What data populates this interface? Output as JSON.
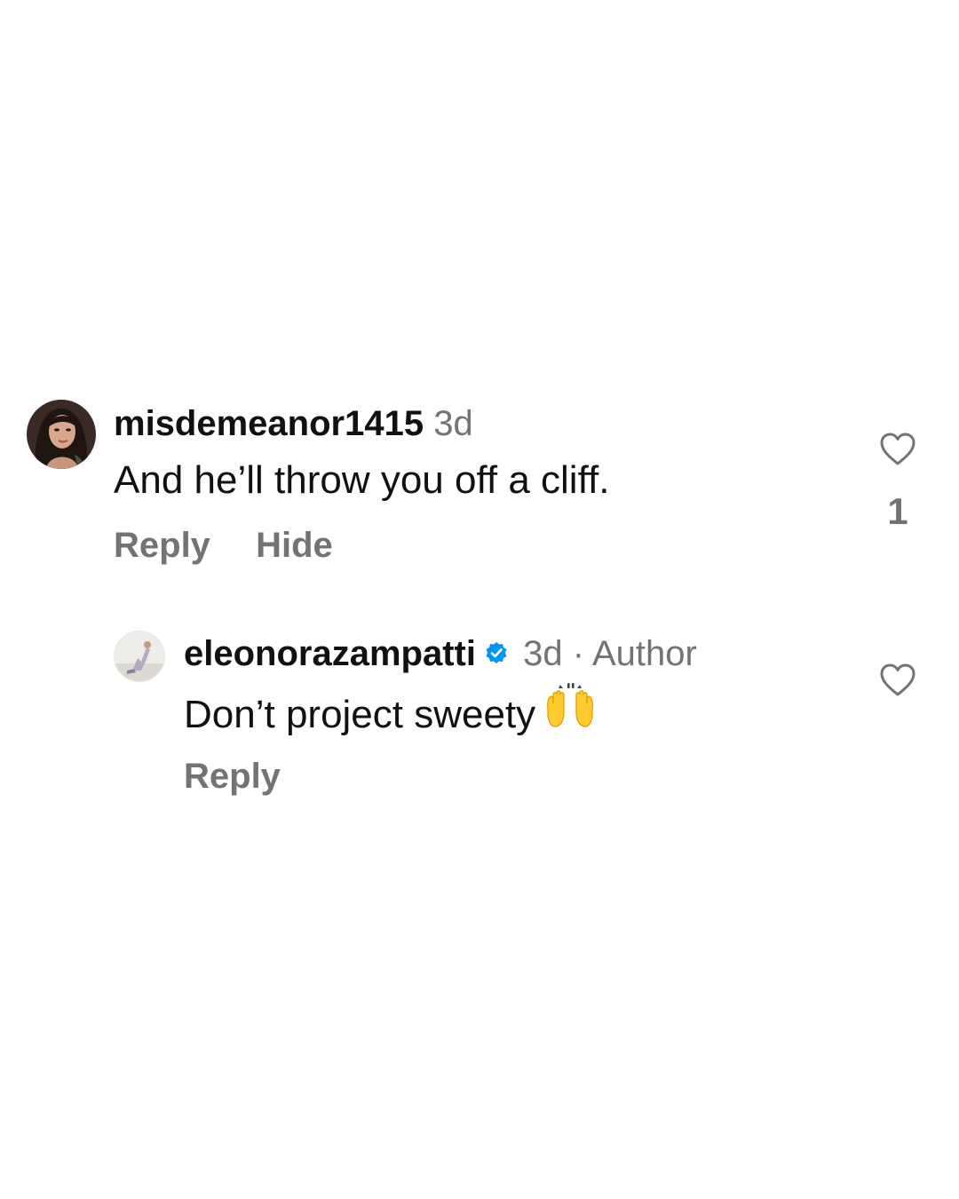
{
  "comments": [
    {
      "username": "misdemeanor1415",
      "time": "3d",
      "text": "And he’ll throw you off a cliff.",
      "actions": [
        "Reply",
        "Hide"
      ],
      "like_count": "1",
      "like_icon": "heart-outline-icon"
    },
    {
      "username": "eleonorazampatti",
      "verified": true,
      "time": "3d",
      "separator": "·",
      "badge": "Author",
      "text": "Don’t project sweety",
      "emoji": "raising-hands-emoji",
      "actions": [
        "Reply"
      ],
      "like_icon": "heart-outline-icon"
    }
  ],
  "colors": {
    "primary_text": "#111111",
    "secondary_text": "#737373",
    "verified_badge": "#0095f6",
    "heart_outline": "#737373"
  }
}
